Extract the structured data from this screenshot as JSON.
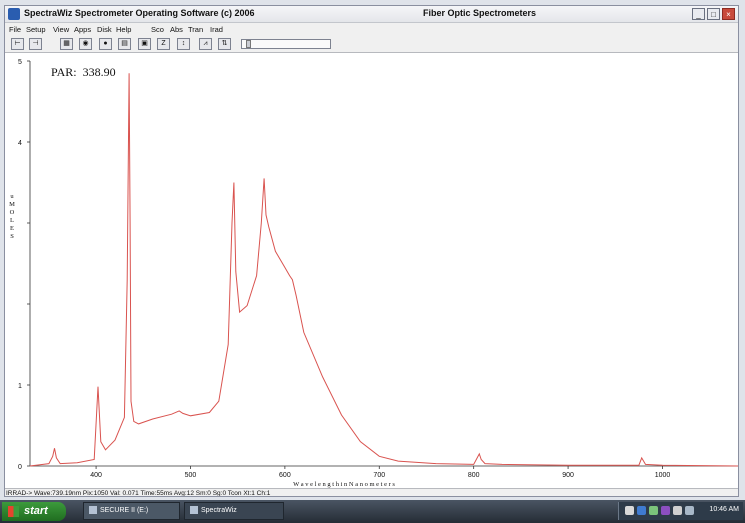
{
  "window": {
    "title_left": "SpectraWiz  Spectrometer Operating Software (c) 2006",
    "title_right": "Fiber Optic Spectrometers"
  },
  "menu": [
    "File",
    "Setup",
    "View",
    "Apps",
    "Disk",
    "Help",
    "Sco",
    "Abs",
    "Tran",
    "Irad"
  ],
  "toolbar": {
    "buttons": [
      {
        "icon": "cursor-left-icon",
        "glyph": "⊢"
      },
      {
        "icon": "cursor-right-icon",
        "glyph": "⊣"
      },
      {
        "icon": "printer-icon",
        "glyph": "▦"
      },
      {
        "icon": "camera-icon",
        "glyph": "◉"
      },
      {
        "icon": "lightbulb-icon",
        "glyph": "●"
      },
      {
        "icon": "save-icon",
        "glyph": "▤"
      },
      {
        "icon": "monitor-icon",
        "glyph": "▣"
      },
      {
        "icon": "zero-icon",
        "glyph": "Z"
      },
      {
        "icon": "scale-icon",
        "glyph": "↕"
      },
      {
        "icon": "peak-icon",
        "glyph": "⩘"
      },
      {
        "icon": "baseline-icon",
        "glyph": "⇅"
      }
    ]
  },
  "readout": {
    "par_label": "PAR:",
    "par_value": "338.90"
  },
  "chart_data": {
    "type": "line",
    "xlabel": "W a v e l e n g t h   i n   N a n o m e t e r s",
    "ylabel": "u M O L E S",
    "xlim": [
      330,
      1080
    ],
    "ylim": [
      0,
      5
    ],
    "x_ticks": [
      400,
      500,
      600,
      700,
      800,
      900,
      1000
    ],
    "y_ticks": [
      0,
      1,
      2,
      3,
      4,
      5
    ],
    "y_tick_labels": [
      "0",
      "1",
      "",
      "",
      "4",
      "5"
    ],
    "line_color": "#d9534f",
    "series": [
      {
        "x": [
          330,
          350,
          354,
          356,
          358,
          362,
          380,
          398,
          402,
          405,
          410,
          420,
          430,
          433,
          435,
          436,
          437,
          440,
          445,
          460,
          480,
          488,
          492,
          500,
          520,
          530,
          540,
          544,
          546,
          548,
          552,
          560,
          570,
          575,
          578,
          580,
          583,
          590,
          600,
          605,
          608,
          612,
          620,
          640,
          660,
          680,
          700,
          720,
          760,
          800,
          806,
          808,
          812,
          830,
          900,
          975,
          978,
          982,
          1000,
          1080
        ],
        "y": [
          0.0,
          0.03,
          0.12,
          0.22,
          0.1,
          0.03,
          0.04,
          0.08,
          0.98,
          0.3,
          0.2,
          0.32,
          0.6,
          2.3,
          4.85,
          3.0,
          0.8,
          0.55,
          0.52,
          0.58,
          0.64,
          0.68,
          0.65,
          0.62,
          0.66,
          0.8,
          1.5,
          3.0,
          3.5,
          2.4,
          1.9,
          1.98,
          2.35,
          3.0,
          3.55,
          3.1,
          2.95,
          2.65,
          2.45,
          2.35,
          2.3,
          2.1,
          1.65,
          1.1,
          0.63,
          0.3,
          0.12,
          0.06,
          0.03,
          0.02,
          0.15,
          0.08,
          0.03,
          0.02,
          0.01,
          0.01,
          0.1,
          0.02,
          0.01,
          0.0
        ]
      }
    ]
  },
  "status": "IRRAD->  Wave:739.19nm  Pix:1050  Val: 0.071  Time:55ms  Avg:12  Sm:0  Sg:0  Tcon  Xt:1  Ch:1",
  "taskbar": {
    "start_label": "start",
    "tasks": [
      "SECURE II (E:)",
      "SpectraWiz"
    ],
    "clock": "10:46 AM"
  }
}
